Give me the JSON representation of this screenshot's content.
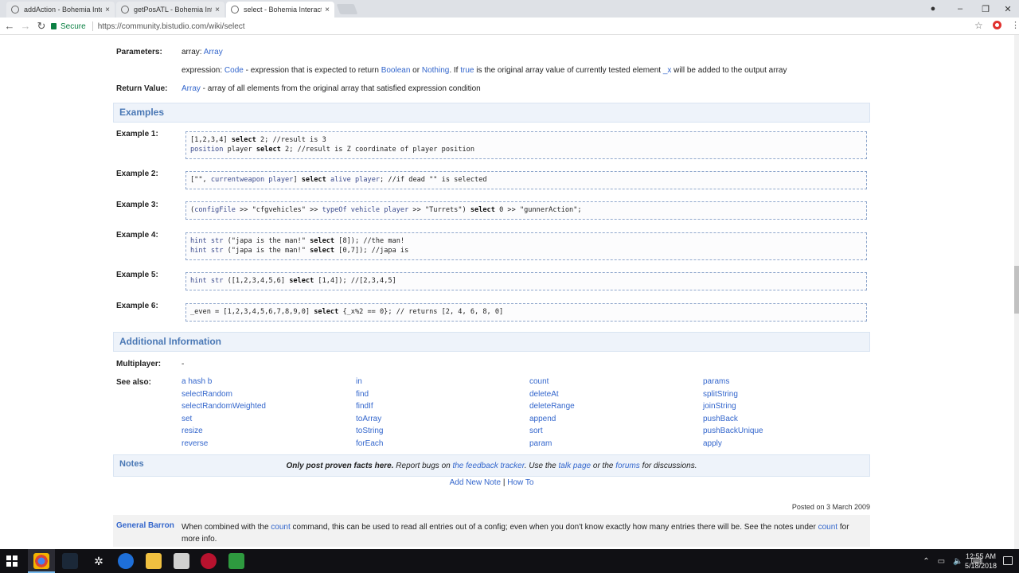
{
  "browser": {
    "tabs": [
      {
        "title": "addAction - Bohemia Inter"
      },
      {
        "title": "getPosATL - Bohemia Inte"
      },
      {
        "title": "select - Bohemia Interact"
      }
    ],
    "close_glyph": "×",
    "secure_label": "Secure",
    "url_prefix": "https://",
    "url_host": "community.bistudio.com",
    "url_path": "/wiki/select"
  },
  "params": {
    "parameters_label": "Parameters:",
    "array_text": "array: ",
    "array_link": "Array",
    "expr_text": "expression: ",
    "expr_code": "Code",
    "expr_mid": " - expression that is expected to return ",
    "expr_bool": "Boolean",
    "expr_or": " or ",
    "expr_nothing": "Nothing",
    "expr_dot": ". If ",
    "expr_true": "true",
    "expr_rest": " is the original array value of currently tested element ",
    "expr_x": "_x",
    "expr_end": " will be added to the output array",
    "return_label": "Return Value:",
    "return_link": "Array",
    "return_text": " - array of all elements from the original array that satisfied expression condition"
  },
  "examples": {
    "heading": "Examples",
    "items": [
      {
        "label": "Example 1:"
      },
      {
        "label": "Example 2:"
      },
      {
        "label": "Example 3:"
      },
      {
        "label": "Example 4:"
      },
      {
        "label": "Example 5:"
      },
      {
        "label": "Example 6:"
      }
    ],
    "code": {
      "e1l1a": "[1,2,3,4] ",
      "e1l1b": "select",
      "e1l1c": " 2; //result is 3",
      "e1l2a": "position",
      "e1l2b": " player ",
      "e1l2c": "select",
      "e1l2d": " 2; //result is Z coordinate of player position",
      "e2a": "[\"\", ",
      "e2b": "currentweapon player",
      "e2c": "] ",
      "e2d": "select",
      "e2e": " ",
      "e2f": "alive player",
      "e2g": "; //if dead \"\" is selected",
      "e3a": "(",
      "e3b": "configFile",
      "e3c": " >> \"cfgvehicles\" >> ",
      "e3d": "typeOf vehicle player",
      "e3e": " >> \"Turrets\") ",
      "e3f": "select",
      "e3g": " 0 >> \"gunnerAction\";",
      "e4l1a": "hint str",
      "e4l1b": " (\"japa is the man!\" ",
      "e4l1c": "select",
      "e4l1d": " [8]); //the man!",
      "e4l2a": "hint str",
      "e4l2b": " (\"japa is the man!\" ",
      "e4l2c": "select",
      "e4l2d": " [0,7]); //japa is",
      "e5a": "hint str",
      "e5b": " ([1,2,3,4,5,6] ",
      "e5c": "select",
      "e5d": " [1,4]); //[2,3,4,5]",
      "e6a": "_even = [1,2,3,4,5,6,7,8,9,0] ",
      "e6b": "select",
      "e6c": " {_x%2 == 0}; // returns [2, 4, 6, 8, 0]"
    }
  },
  "additional": {
    "heading": "Additional Information",
    "multiplayer_label": "Multiplayer:",
    "multiplayer_value": "-",
    "see_also_label": "See also:",
    "see_also_cols": [
      [
        "a hash b",
        "selectRandom",
        "selectRandomWeighted",
        "set",
        "resize",
        "reverse"
      ],
      [
        "in",
        "find",
        "findIf",
        "toArray",
        "toString",
        "forEach"
      ],
      [
        "count",
        "deleteAt",
        "deleteRange",
        "append",
        "sort",
        "param"
      ],
      [
        "params",
        "splitString",
        "joinString",
        "pushBack",
        "pushBackUnique",
        "apply"
      ]
    ]
  },
  "notes": {
    "heading": "Notes",
    "bold": "Only post proven facts here.",
    "t1": " Report bugs on ",
    "link1": "the feedback tracker",
    "t2": ". Use the ",
    "link2": "talk page",
    "t3": " or the ",
    "link3": "forums",
    "t4": " for discussions.",
    "add_note": "Add New Note",
    "divider": " | ",
    "how_to": "How To",
    "posted": "Posted on 3 March 2009",
    "author": "General Barron",
    "text1": "When combined with the ",
    "count1": "count",
    "text2": " command, this can be used to read all entries out of a config; even when you don't know exactly how many entries there will be. See the notes under ",
    "count2": "count",
    "text3": " for more info."
  },
  "taskbar": {
    "time": "12:55 AM",
    "date": "5/18/2018"
  }
}
